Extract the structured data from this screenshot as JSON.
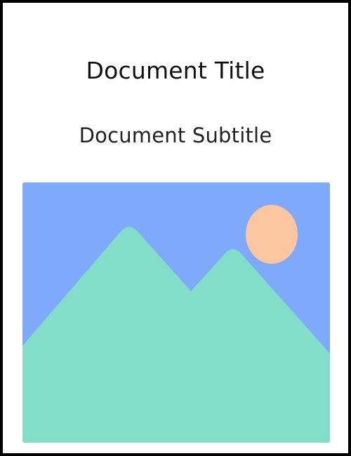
{
  "document": {
    "title": "Document Title",
    "subtitle": "Document Subtitle"
  },
  "image": {
    "icon": "landscape-image-placeholder-icon",
    "colors": {
      "sky": "#7FA9FA",
      "mountains": "#82DDC9",
      "sun": "#FCC6A0"
    }
  },
  "colors": {
    "border": "#000000",
    "background": "#FFFFFF",
    "text": "#111111"
  }
}
